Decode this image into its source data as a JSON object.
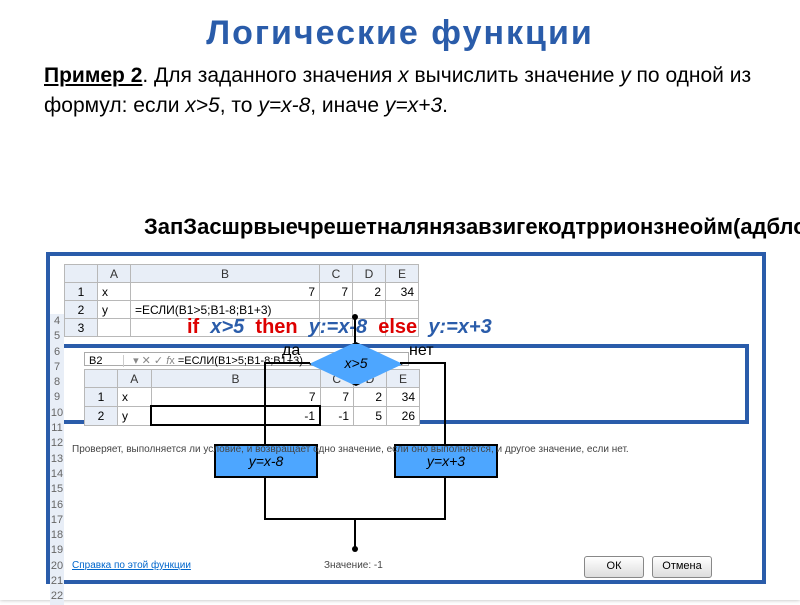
{
  "title": "Логические функции",
  "problem_label": "Пример 2",
  "problem_text_1": ". Для заданного значения ",
  "problem_x": "x",
  "problem_text_2": " вычислить значение ",
  "problem_y": "y",
  "problem_text_3": " по одной из формул: если ",
  "cond": "x>5",
  "problem_text_4": ", то ",
  "f1": "y=x-8",
  "problem_text_5": ", иначе ",
  "f2": "y=x+3",
  "problem_text_6": ".",
  "subhead": "ЗапЗасшрвыечрешетналянязавзигекодтррионзнеойм(адбловарыидтит,ы):",
  "code": {
    "if": "if",
    "cond": "x>5",
    "then": "then",
    "br1": "y:=x-8",
    "else": "else",
    "br2": "y:=x+3"
  },
  "sheet1": {
    "cols": [
      "A",
      "B",
      "C",
      "D",
      "E"
    ],
    "rows": [
      [
        "x",
        "",
        "7",
        "2",
        "34"
      ],
      [
        "y",
        "=ЕСЛИ(B1>5;B1-8;B1+3)",
        "",
        "",
        ""
      ],
      [
        "",
        "",
        "",
        "",
        ""
      ]
    ]
  },
  "fb2": {
    "ref": "B2",
    "fx": "=ЕСЛИ(B1>5;B1-8;B1+3)"
  },
  "sheet2": {
    "cols": [
      "A",
      "B",
      "C",
      "D",
      "E"
    ],
    "rows": [
      [
        "x",
        "",
        "7",
        "2",
        "34"
      ],
      [
        "y",
        "",
        "-1",
        "5",
        "26"
      ]
    ]
  },
  "flow": {
    "cond": "x>5",
    "yes": "да",
    "no": "нет",
    "b1": "y=x-8",
    "b2": "y=x+3"
  },
  "dlg": {
    "hint": "Проверяет, выполняется ли условие, и возвращает одно значение, если оно выполняется, и другое значение, если нет.",
    "help": "Справка по этой функции",
    "val_label": "Значение:",
    "val": "-1",
    "ok": "ОК",
    "cancel": "Отмена"
  }
}
